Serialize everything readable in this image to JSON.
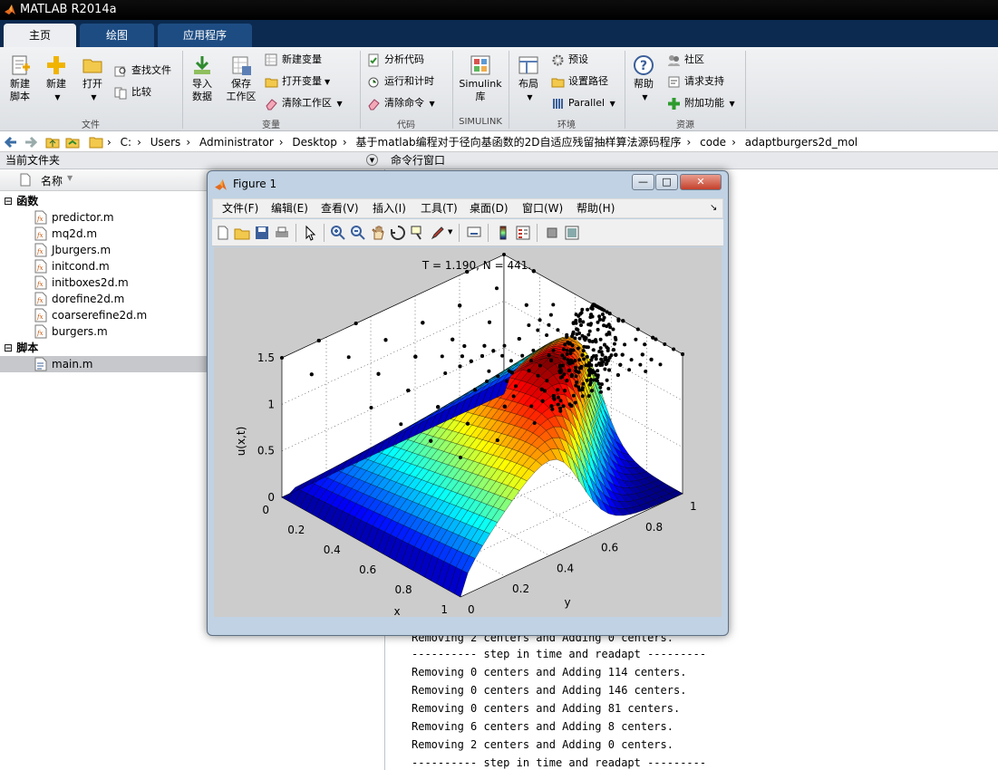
{
  "app": {
    "title": "MATLAB R2014a"
  },
  "tabs": [
    {
      "label": "主页"
    },
    {
      "label": "绘图"
    },
    {
      "label": "应用程序"
    }
  ],
  "ribbon": {
    "new_script": "新建\n脚本",
    "new": "新建",
    "open": "打开",
    "find_files": "查找文件",
    "compare": "比较",
    "import_data": "导入\n数据",
    "save_workspace": "保存\n工作区",
    "new_variable": "新建变量",
    "open_variable": "打开变量",
    "clear_workspace": "清除工作区",
    "analyze_code": "分析代码",
    "run_and_time": "运行和计时",
    "clear_commands": "清除命令",
    "simulink_library": "Simulink\n库",
    "layout": "布局",
    "preferences": "预设",
    "set_path": "设置路径",
    "parallel": "Parallel",
    "help": "帮助",
    "community": "社区",
    "request_support": "请求支持",
    "add_ons": "附加功能",
    "groups": {
      "file": "文件",
      "variable": "变量",
      "code": "代码",
      "simulink": "SIMULINK",
      "environment": "环境",
      "resources": "资源"
    }
  },
  "address": {
    "crumbs": [
      "C:",
      "Users",
      "Administrator",
      "Desktop",
      "基于matlab编程对于径向基函数的2D自适应残留抽样算法源码程序",
      "code",
      "adaptburgers2d_mol"
    ]
  },
  "current_folder": {
    "title": "当前文件夹",
    "name_column": "名称",
    "functions_label": "函数",
    "scripts_label": "脚本",
    "functions": [
      "predictor.m",
      "mq2d.m",
      "Jburgers.m",
      "initcond.m",
      "initboxes2d.m",
      "dorefine2d.m",
      "coarserefine2d.m",
      "burgers.m"
    ],
    "scripts": [
      "main.m"
    ]
  },
  "command_window": {
    "title": "命令行窗口",
    "lines": [
      "Removing 2 centers and Adding 0 centers.",
      "---------- step in time and readapt ---------",
      "Removing 0 centers and Adding 114 centers.",
      "Removing 0 centers and Adding 146 centers.",
      "Removing 0 centers and Adding 81 centers.",
      "Removing 6 centers and Adding 8 centers.",
      "Removing 2 centers and Adding 0 centers.",
      "---------- step in time and readapt ---------"
    ]
  },
  "figure": {
    "title": "Figure 1",
    "menu": [
      "文件(F)",
      "编辑(E)",
      "查看(V)",
      "插入(I)",
      "工具(T)",
      "桌面(D)",
      "窗口(W)",
      "帮助(H)"
    ],
    "plot": {
      "title": "T = 1.190,    N = 441.",
      "zlabel": "u(x,t)",
      "xlabel": "x",
      "ylabel": "y",
      "z_ticks": [
        "0",
        "0.5",
        "1",
        "1.5"
      ],
      "x_ticks": [
        "0",
        "0.2",
        "0.4",
        "0.6",
        "0.8",
        "1"
      ],
      "y_ticks": [
        "0",
        "0.2",
        "0.4",
        "0.6",
        "0.8",
        "1"
      ]
    }
  }
}
